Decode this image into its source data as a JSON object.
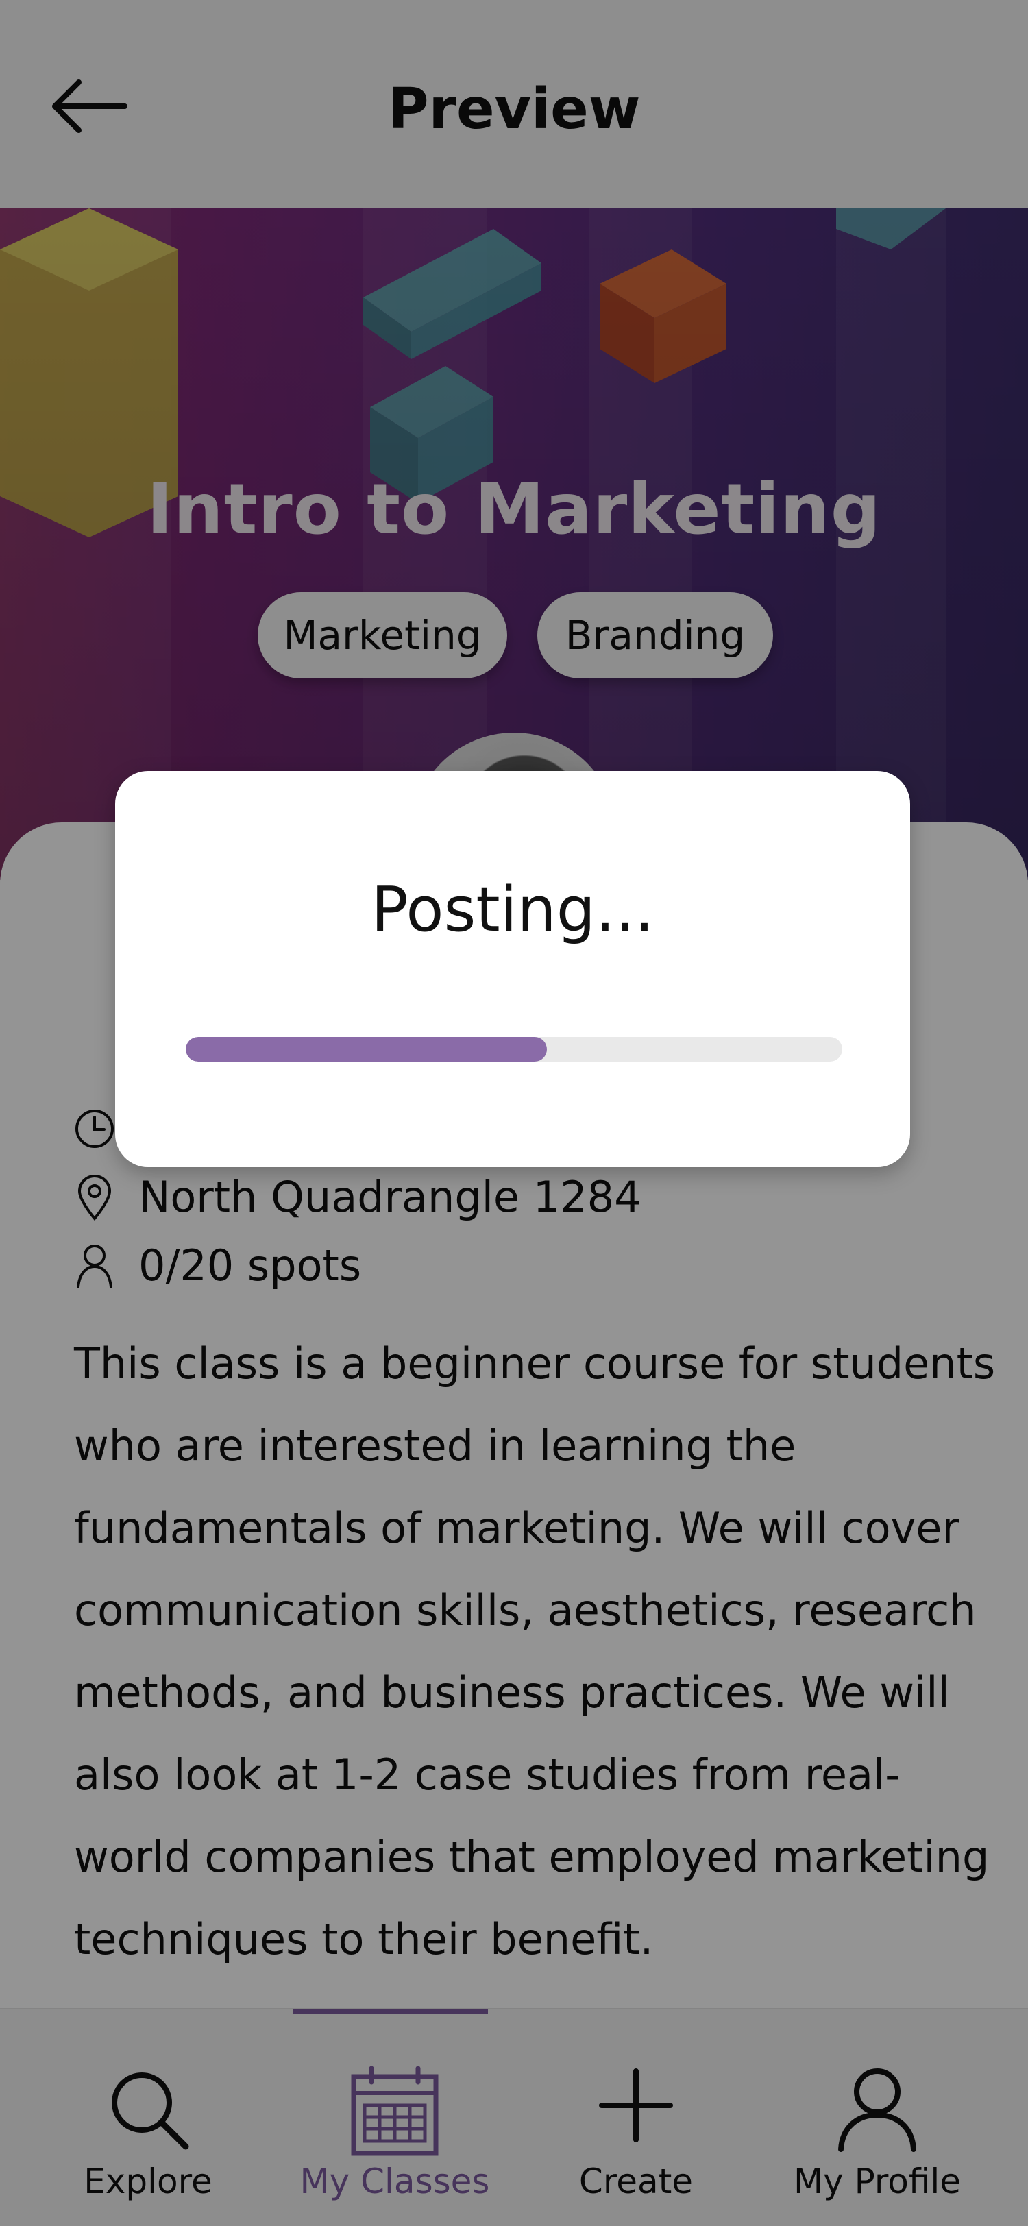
{
  "header": {
    "title": "Preview"
  },
  "class": {
    "title": "Intro to Marketing",
    "tags": [
      "Marketing",
      "Branding"
    ],
    "location": "North Quadrangle 1284",
    "spots": "0/20 spots",
    "description": "This class is a beginner course for students who are interested in learning the fundamentals of marketing. We will cover communication skills, aesthetics, research methods, and business practices. We will also look at 1-2 case studies from real-world companies that employed marketing techniques to their benefit."
  },
  "modal": {
    "title": "Posting...",
    "progress": 0.55
  },
  "nav": {
    "items": [
      {
        "label": "Explore",
        "icon": "search-icon",
        "active": false
      },
      {
        "label": "My Classes",
        "icon": "calendar-icon",
        "active": true
      },
      {
        "label": "Create",
        "icon": "plus-icon",
        "active": false
      },
      {
        "label": "My Profile",
        "icon": "person-icon",
        "active": false
      }
    ]
  },
  "colors": {
    "accent": "#8a6ba8",
    "nav_active": "#7a5a9e"
  }
}
